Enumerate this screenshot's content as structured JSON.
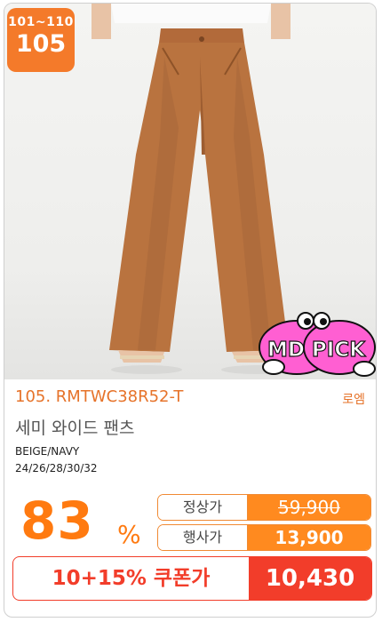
{
  "badge": {
    "range": "101~110",
    "number": "105"
  },
  "mdpick": {
    "label": "MD PICK"
  },
  "product": {
    "code": "105. RMTWC38R52-T",
    "brand": "로엠",
    "name": "세미 와이드 팬츠",
    "colors": "BEIGE/NAVY",
    "sizes": "24/26/28/30/32"
  },
  "pricing": {
    "discount": "83",
    "percent_sign": "%",
    "regular_label": "정상가",
    "regular_price": "59,900",
    "event_label": "행사가",
    "event_price": "13,900"
  },
  "coupon": {
    "label": "10+15% 쿠폰가",
    "price": "10,430"
  },
  "colors": {
    "accent": "#ff8a1f",
    "coupon": "#f23d2a",
    "badge": "#f47a2a"
  }
}
